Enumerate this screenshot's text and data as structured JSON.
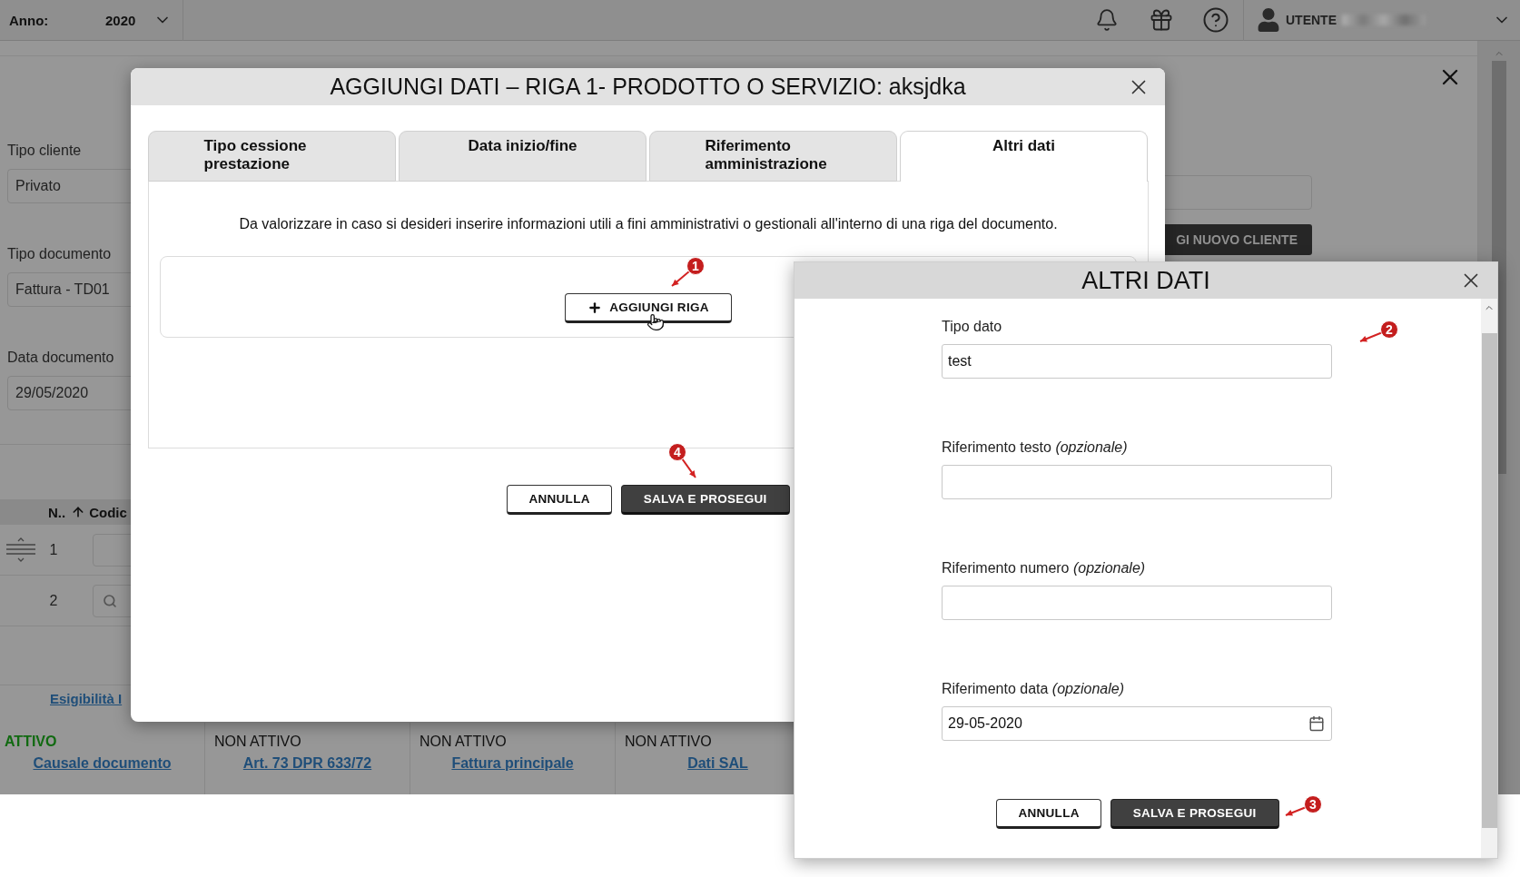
{
  "top_bar": {
    "year_label": "Anno:",
    "year": "2020",
    "user": "UTENTE"
  },
  "background_page": {
    "fields": [
      {
        "label": "Tipo cliente",
        "value": "Privato"
      },
      {
        "label": "Tipo documento",
        "value": "Fattura - TD01"
      },
      {
        "label": "Data documento",
        "value": "29/05/2020"
      }
    ],
    "right_button": "GI NUOVO CLIENTE",
    "table": {
      "columns": [
        "N..",
        "Codic"
      ],
      "rows": [
        {
          "number": "1",
          "kind": "handle"
        },
        {
          "number": "2",
          "kind": "search"
        }
      ]
    },
    "link": "Esigibilità I",
    "status_strip": [
      {
        "state": "ATTIVO",
        "active": true,
        "link": "Causale documento"
      },
      {
        "state": "NON ATTIVO",
        "active": false,
        "link": "Art. 73 DPR 633/72"
      },
      {
        "state": "NON ATTIVO",
        "active": false,
        "link": "Fattura principale"
      },
      {
        "state": "NON ATTIVO",
        "active": false,
        "link": "Dati SAL"
      }
    ]
  },
  "main_dialog": {
    "title": "AGGIUNGI DATI – RIGA 1- PRODOTTO O SERVIZIO: aksjdka",
    "tabs": [
      {
        "label": "Tipo cessione prestazione",
        "selected": false
      },
      {
        "label": "Data inizio/fine",
        "selected": false
      },
      {
        "label": "Riferimento amministrazione",
        "selected": false
      },
      {
        "label": "Altri dati",
        "selected": true
      }
    ],
    "description": "Da valorizzare in caso si desideri inserire informazioni utili a fini amministrativi o gestionali all'interno di una riga del documento.",
    "add_row_button": "AGGIUNGI RIGA",
    "buttons": [
      {
        "label": "ANNULLA",
        "kind": "secondary"
      },
      {
        "label": "SALVA E PROSEGUI",
        "kind": "primary"
      }
    ]
  },
  "sub_dialog": {
    "title": "ALTRI DATI",
    "fields": [
      {
        "label": "Tipo dato",
        "value": "test",
        "kind": "text"
      },
      {
        "label": "Riferimento testo *(opzionale)*",
        "kind": "text"
      },
      {
        "label": "Riferimento numero *(opzionale)*",
        "kind": "text"
      },
      {
        "label": "Riferimento data *(opzionale)*",
        "value": "29-05-2020",
        "kind": "date"
      }
    ],
    "buttons": [
      {
        "label": "ANNULLA",
        "kind": "secondary"
      },
      {
        "label": "SALVA E PROSEGUI",
        "kind": "primary"
      }
    ]
  },
  "annotations": [
    {
      "number": "1"
    },
    {
      "number": "2"
    },
    {
      "number": "3"
    },
    {
      "number": "4"
    }
  ]
}
